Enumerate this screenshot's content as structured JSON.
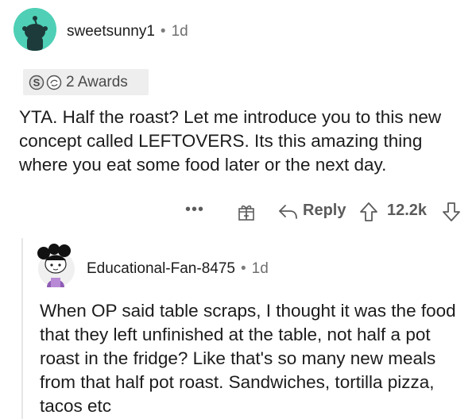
{
  "comment": {
    "username": "sweetsunny1",
    "separator": "•",
    "age": "1d",
    "awards_label": "2 Awards",
    "body": "YTA.  Half the roast?  Let me introduce you to this new concept called LEFTOVERS.  Its this amazing thing where you eat some food later or the next day.",
    "actions": {
      "more": "•••",
      "reply_label": "Reply",
      "score": "12.2k"
    }
  },
  "reply": {
    "username": "Educational-Fan-8475",
    "separator": "•",
    "age": "1d",
    "body": "When OP said table scraps, I thought it was the food that they left unfinished at the table, not half a pot roast in the fridge? Like that's so many new meals from that half pot roast. Sandwiches, tortilla pizza, tacos etc"
  },
  "colors": {
    "avatar_bg": "#4fd0b6",
    "action_gray": "#5b5b5b",
    "award_bg": "#eeeeee"
  },
  "icons": [
    "snoo-avatar-icon",
    "silver-award-icon",
    "helpful-award-icon",
    "more-options-icon",
    "gift-icon",
    "reply-arrow-icon",
    "upvote-icon",
    "downvote-icon",
    "user-avatar-icon"
  ]
}
